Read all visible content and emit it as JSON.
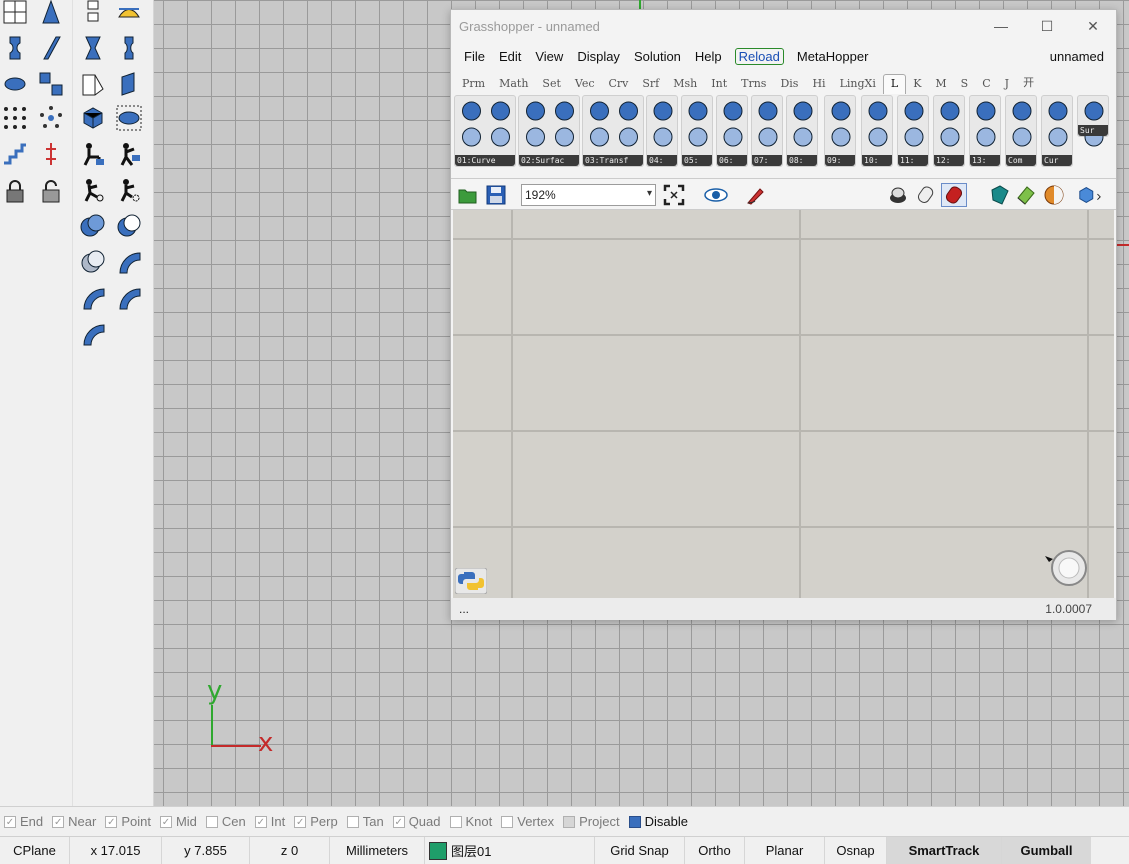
{
  "grasshopper": {
    "title": "Grasshopper - unnamed",
    "window_controls": {
      "minimize": "—",
      "maximize": "☐",
      "close": "✕"
    },
    "menu": [
      "File",
      "Edit",
      "View",
      "Display",
      "Solution",
      "Help",
      "Reload",
      "MetaHopper"
    ],
    "document_name": "unnamed",
    "tabs": [
      "Prm",
      "Math",
      "Set",
      "Vec",
      "Crv",
      "Srf",
      "Msh",
      "Int",
      "Trns",
      "Dis",
      "Hi",
      "LingXi",
      "L",
      "K",
      "M",
      "S",
      "C",
      "J",
      "开"
    ],
    "active_tab": "L",
    "ribbon_groups": [
      "01:Curve",
      "02:Surfac",
      "03:Transf",
      "04:",
      "05:",
      "06:",
      "07:",
      "08:",
      "09:",
      "10:",
      "11:",
      "12:",
      "13:",
      "Com",
      "Cur",
      "Sur"
    ],
    "zoom": "192%",
    "status_left": "...",
    "version": "1.0.0007"
  },
  "viewport": {
    "axis_x_label": "x",
    "axis_y_label": "y"
  },
  "osnap": {
    "items": [
      {
        "label": "End",
        "checked": true
      },
      {
        "label": "Near",
        "checked": true
      },
      {
        "label": "Point",
        "checked": true
      },
      {
        "label": "Mid",
        "checked": true
      },
      {
        "label": "Cen",
        "checked": false
      },
      {
        "label": "Int",
        "checked": true
      },
      {
        "label": "Perp",
        "checked": true
      },
      {
        "label": "Tan",
        "checked": false
      },
      {
        "label": "Quad",
        "checked": true
      },
      {
        "label": "Knot",
        "checked": false
      },
      {
        "label": "Vertex",
        "checked": false
      },
      {
        "label": "Project",
        "checked": false
      },
      {
        "label": "Disable",
        "checked": false
      }
    ]
  },
  "statusbar": {
    "cplane": "CPlane",
    "x": "x 17.015",
    "y": "y 7.855",
    "z": "z 0",
    "units": "Millimeters",
    "layer": "图层01",
    "layer_color": "#1f9e6a",
    "grid_snap": "Grid Snap",
    "ortho": "Ortho",
    "planar": "Planar",
    "osnap": "Osnap",
    "smarttrack": "SmartTrack",
    "gumball": "Gumball"
  },
  "colors": {
    "axis_x": "#c42a2a",
    "axis_y": "#2fa82f",
    "icon_blue": "#3a6fbd"
  }
}
